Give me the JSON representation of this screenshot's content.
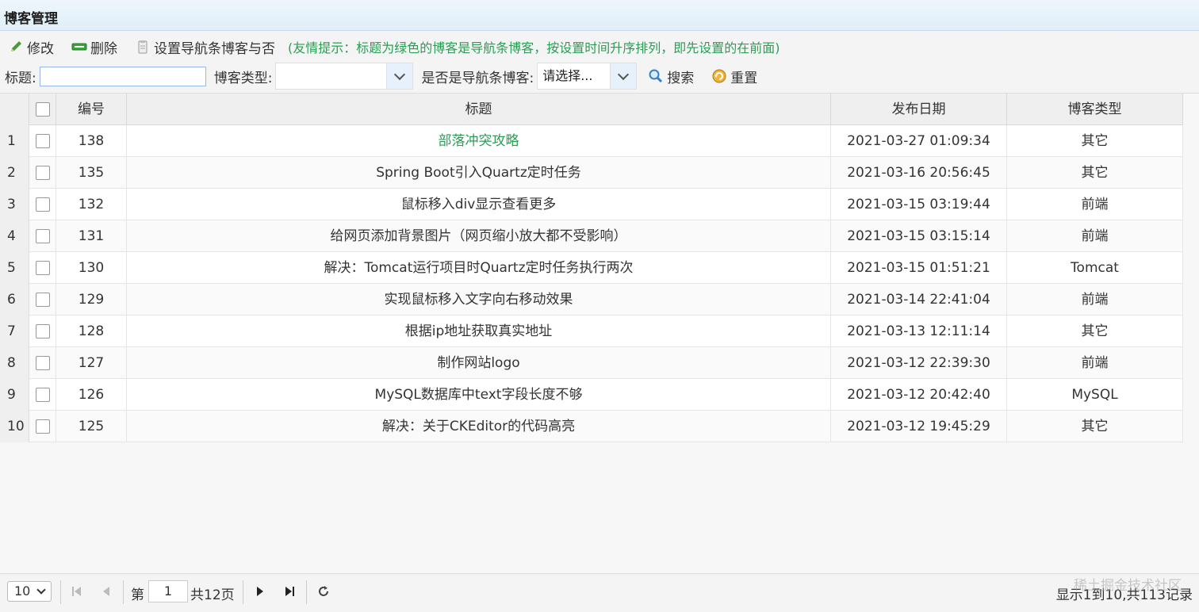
{
  "panel": {
    "title": "博客管理"
  },
  "toolbar": {
    "edit_label": "修改",
    "delete_label": "删除",
    "nav_label": "设置导航条博客与否",
    "tip": "(友情提示：标题为绿色的博客是导航条博客，按设置时间升序排列，即先设置的在前面)"
  },
  "search": {
    "title_label": "标题:",
    "title_value": "",
    "type_label": "博客类型:",
    "type_value": "",
    "nav_label": "是否是导航条博客:",
    "nav_value": "请选择...",
    "search_label": "搜索",
    "reset_label": "重置"
  },
  "table": {
    "headers": {
      "id": "编号",
      "title": "标题",
      "date": "发布日期",
      "type": "博客类型"
    },
    "rows": [
      {
        "num": "1",
        "id": "138",
        "title": "部落冲突攻略",
        "date": "2021-03-27 01:09:34",
        "type": "其它",
        "nav": true
      },
      {
        "num": "2",
        "id": "135",
        "title": "Spring Boot引入Quartz定时任务",
        "date": "2021-03-16 20:56:45",
        "type": "其它",
        "nav": false
      },
      {
        "num": "3",
        "id": "132",
        "title": "鼠标移入div显示查看更多",
        "date": "2021-03-15 03:19:44",
        "type": "前端",
        "nav": false
      },
      {
        "num": "4",
        "id": "131",
        "title": "给网页添加背景图片（网页缩小放大都不受影响）",
        "date": "2021-03-15 03:15:14",
        "type": "前端",
        "nav": false
      },
      {
        "num": "5",
        "id": "130",
        "title": "解决：Tomcat运行项目时Quartz定时任务执行两次",
        "date": "2021-03-15 01:51:21",
        "type": "Tomcat",
        "nav": false
      },
      {
        "num": "6",
        "id": "129",
        "title": "实现鼠标移入文字向右移动效果",
        "date": "2021-03-14 22:41:04",
        "type": "前端",
        "nav": false
      },
      {
        "num": "7",
        "id": "128",
        "title": "根据ip地址获取真实地址",
        "date": "2021-03-13 12:11:14",
        "type": "其它",
        "nav": false
      },
      {
        "num": "8",
        "id": "127",
        "title": "制作网站logo",
        "date": "2021-03-12 22:39:30",
        "type": "前端",
        "nav": false
      },
      {
        "num": "9",
        "id": "126",
        "title": "MySQL数据库中text字段长度不够",
        "date": "2021-03-12 20:42:40",
        "type": "MySQL",
        "nav": false
      },
      {
        "num": "10",
        "id": "125",
        "title": "解决：关于CKEditor的代码高亮",
        "date": "2021-03-12 19:45:29",
        "type": "其它",
        "nav": false
      }
    ]
  },
  "pager": {
    "page_size": "10",
    "page_prefix": "第",
    "page_value": "1",
    "page_suffix": "共12页",
    "info": "显示1到10,共113记录",
    "watermark": "稀土掘金技术社区"
  },
  "colors": {
    "nav_title": "#2a9d55",
    "header_bg": "#dfeef9"
  }
}
